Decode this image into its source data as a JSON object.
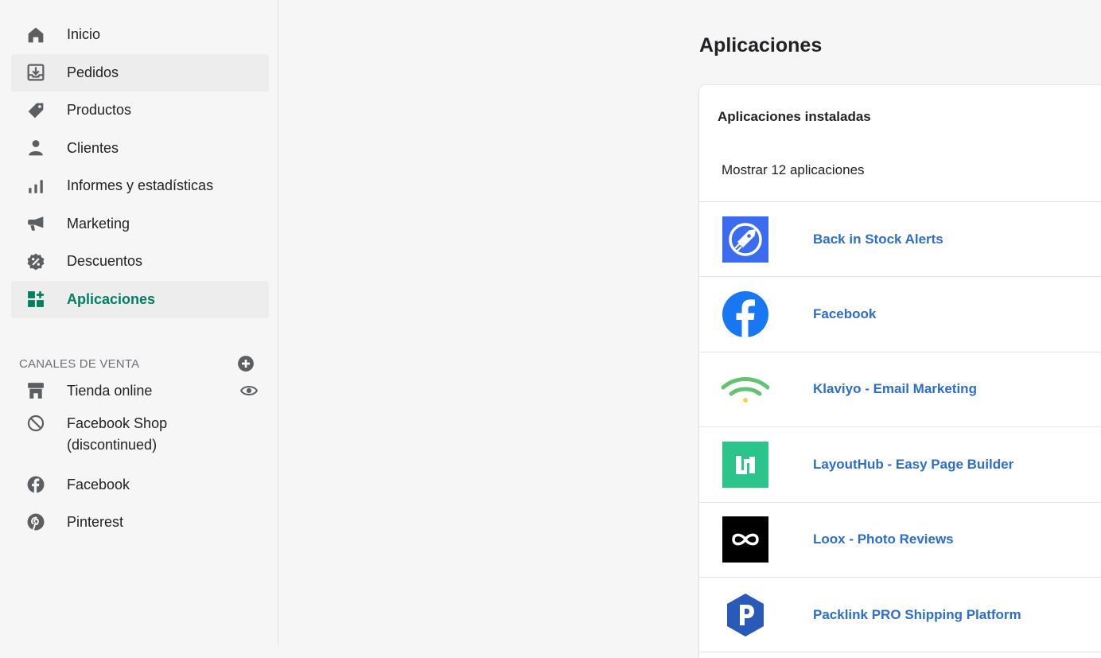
{
  "sidebar": {
    "nav": [
      {
        "label": "Inicio",
        "icon": "home-icon"
      },
      {
        "label": "Pedidos",
        "icon": "orders-icon"
      },
      {
        "label": "Productos",
        "icon": "tag-icon"
      },
      {
        "label": "Clientes",
        "icon": "person-icon"
      },
      {
        "label": "Informes y estadísticas",
        "icon": "bar-chart-icon"
      },
      {
        "label": "Marketing",
        "icon": "megaphone-icon"
      },
      {
        "label": "Descuentos",
        "icon": "discount-icon"
      },
      {
        "label": "Aplicaciones",
        "icon": "apps-icon"
      }
    ],
    "sales_channels_title": "CANALES DE VENTA",
    "channels": [
      {
        "label": "Tienda online",
        "icon": "store-icon"
      },
      {
        "label_line1": "Facebook Shop",
        "label_line2": "(discontinued)",
        "icon": "blocked-icon"
      },
      {
        "label": "Facebook",
        "icon": "facebook-icon"
      },
      {
        "label": "Pinterest",
        "icon": "pinterest-icon"
      }
    ]
  },
  "main": {
    "title": "Aplicaciones",
    "card_title": "Aplicaciones instaladas",
    "show_count": "Mostrar 12 aplicaciones",
    "apps": [
      {
        "name": "Back in Stock Alerts",
        "icon": "rocket-icon"
      },
      {
        "name": "Facebook",
        "icon": "facebook-icon"
      },
      {
        "name": "Klaviyo - Email Marketing",
        "icon": "klaviyo-icon"
      },
      {
        "name": "LayoutHub - Easy Page Builder",
        "icon": "layouthub-icon"
      },
      {
        "name": "Loox - Photo Reviews",
        "icon": "infinity-icon"
      },
      {
        "name": "Packlink PRO Shipping Platform",
        "icon": "packlink-icon"
      }
    ]
  },
  "colors": {
    "active_green": "#008060",
    "link_blue": "#2c6ecb",
    "icon_gray": "#5c5f62"
  }
}
